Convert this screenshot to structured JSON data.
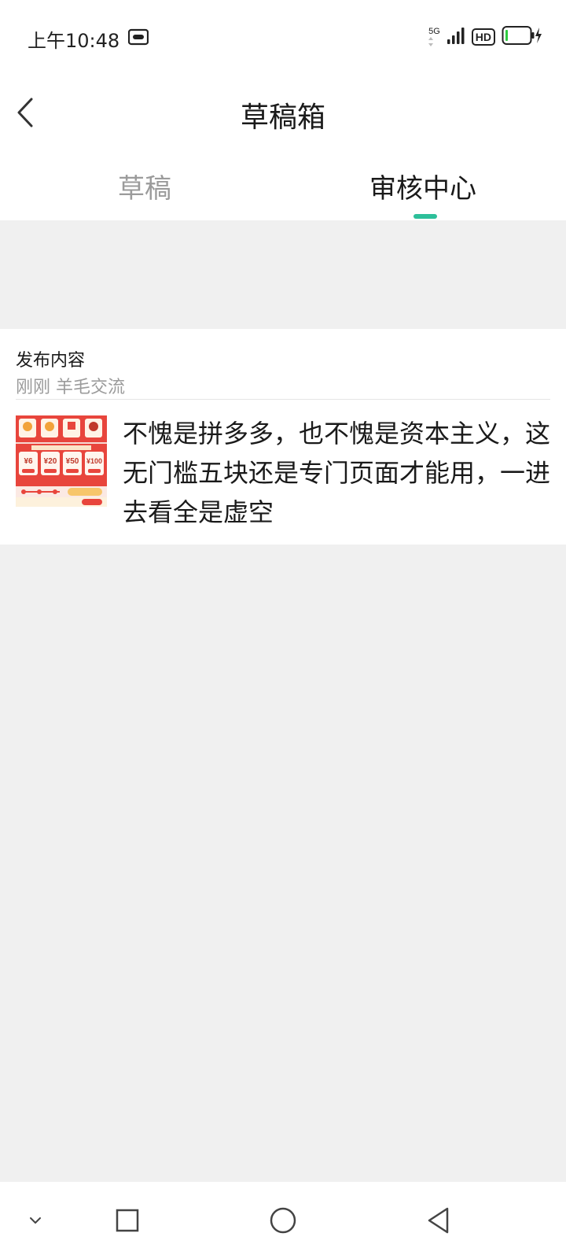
{
  "status_bar": {
    "time": "上午10:48",
    "network": "5G",
    "hd": "HD",
    "media_icon": "cassette-icon",
    "signal_icon": "signal-icon",
    "battery_icon": "battery-charging-icon"
  },
  "header": {
    "title": "草稿箱",
    "back_icon": "back-chevron-icon"
  },
  "tabs": [
    {
      "label": "草稿",
      "active": false
    },
    {
      "label": "审核中心",
      "active": true
    }
  ],
  "colors": {
    "accent": "#2dbf9a",
    "background": "#f0f0f0",
    "muted_text": "#9b9b9b"
  },
  "card": {
    "title": "发布内容",
    "meta": "刚刚 羊毛交流",
    "thumbnail": {
      "icon": "coupon-screenshot-thumbnail",
      "coupon_values": [
        "¥6",
        "¥20",
        "¥50",
        "¥100"
      ]
    },
    "text": "不愧是拼多多，也不愧是资本主义，这无门槛五块还是专门页面才能用，一进去看全是虚空"
  },
  "nav_bar": {
    "buttons": [
      "chevron-down-icon",
      "recents-square-icon",
      "home-circle-icon",
      "back-triangle-icon"
    ]
  }
}
